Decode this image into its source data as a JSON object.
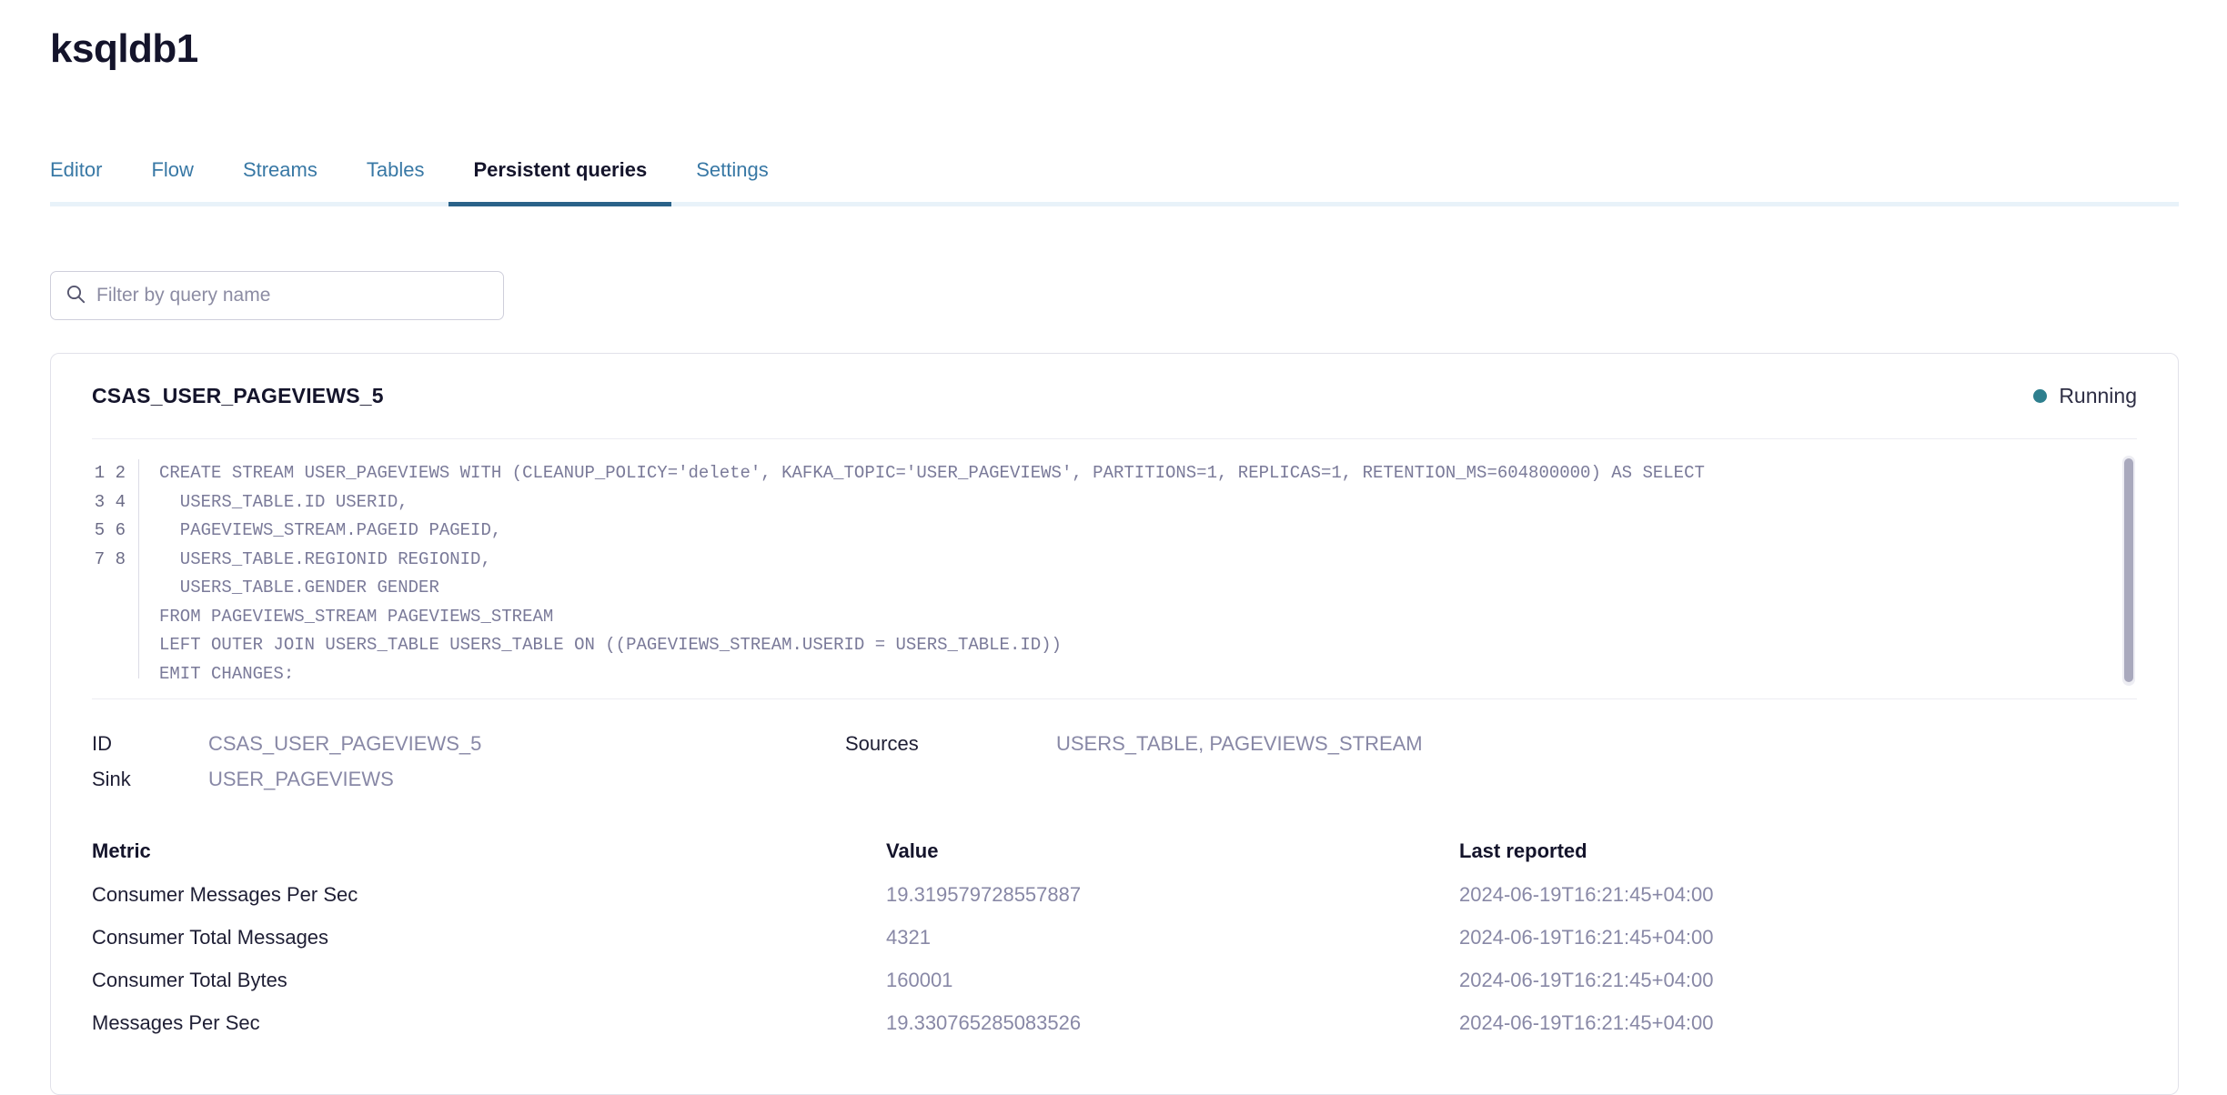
{
  "header": {
    "title": "ksqldb1"
  },
  "tabs": [
    {
      "label": "Editor",
      "active": false
    },
    {
      "label": "Flow",
      "active": false
    },
    {
      "label": "Streams",
      "active": false
    },
    {
      "label": "Tables",
      "active": false
    },
    {
      "label": "Persistent queries",
      "active": true
    },
    {
      "label": "Settings",
      "active": false
    }
  ],
  "search": {
    "placeholder": "Filter by query name",
    "value": "",
    "icon": "search-icon"
  },
  "query_card": {
    "name": "CSAS_USER_PAGEVIEWS_5",
    "status": {
      "label": "Running",
      "color": "#2e7f8e"
    },
    "code": {
      "line_numbers": [
        "1",
        "2",
        "3",
        "4",
        "5",
        "6",
        "7",
        "8"
      ],
      "lines": [
        "CREATE STREAM USER_PAGEVIEWS WITH (CLEANUP_POLICY='delete', KAFKA_TOPIC='USER_PAGEVIEWS', PARTITIONS=1, REPLICAS=1, RETENTION_MS=604800000) AS SELECT",
        "  USERS_TABLE.ID USERID,",
        "  PAGEVIEWS_STREAM.PAGEID PAGEID,",
        "  USERS_TABLE.REGIONID REGIONID,",
        "  USERS_TABLE.GENDER GENDER",
        "FROM PAGEVIEWS_STREAM PAGEVIEWS_STREAM",
        "LEFT OUTER JOIN USERS_TABLE USERS_TABLE ON ((PAGEVIEWS_STREAM.USERID = USERS_TABLE.ID))",
        "EMIT CHANGES;"
      ]
    },
    "meta": {
      "id_label": "ID",
      "id_value": "CSAS_USER_PAGEVIEWS_5",
      "sources_label": "Sources",
      "sources_value": "USERS_TABLE, PAGEVIEWS_STREAM",
      "sink_label": "Sink",
      "sink_value": "USER_PAGEVIEWS"
    },
    "metrics_table": {
      "columns": [
        "Metric",
        "Value",
        "Last reported"
      ],
      "rows": [
        {
          "metric": "Consumer Messages Per Sec",
          "value": "19.319579728557887",
          "last_reported": "2024-06-19T16:21:45+04:00"
        },
        {
          "metric": "Consumer Total Messages",
          "value": "4321",
          "last_reported": "2024-06-19T16:21:45+04:00"
        },
        {
          "metric": "Consumer Total Bytes",
          "value": "160001",
          "last_reported": "2024-06-19T16:21:45+04:00"
        },
        {
          "metric": "Messages Per Sec",
          "value": "19.330765285083526",
          "last_reported": "2024-06-19T16:21:45+04:00"
        }
      ]
    }
  },
  "colors": {
    "accent": "#2a6289",
    "tab_link": "#3878a5",
    "tab_track": "#e8f2f9",
    "status_running": "#2e7f8e",
    "muted_text": "#8888a6",
    "code_text": "#7a7a99",
    "card_border": "#e2e2ea"
  }
}
